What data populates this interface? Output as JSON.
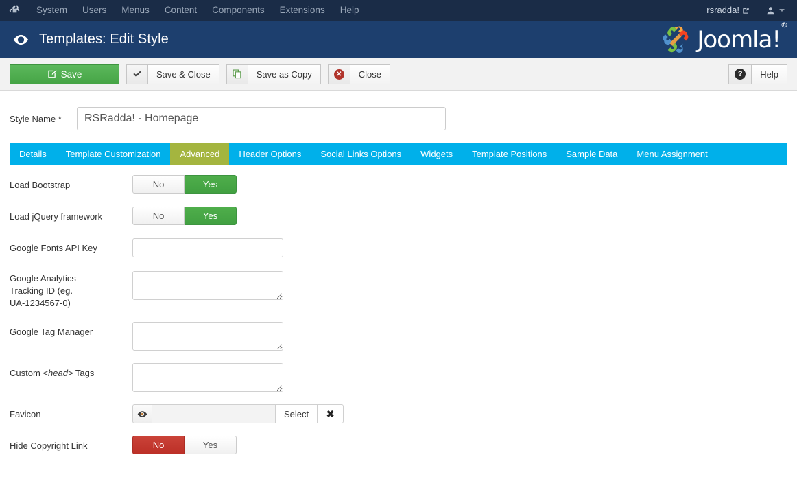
{
  "topnav": {
    "brand_icon": "joomla-mark-icon",
    "items": [
      {
        "label": "System"
      },
      {
        "label": "Users"
      },
      {
        "label": "Menus"
      },
      {
        "label": "Content"
      },
      {
        "label": "Components"
      },
      {
        "label": "Extensions"
      },
      {
        "label": "Help"
      }
    ],
    "site_link_label": "rsradda!",
    "site_link_icon": "external-link-icon",
    "user_icon": "user-icon",
    "caret_icon": "chevron-down-icon"
  },
  "header": {
    "icon": "eye-icon",
    "title": "Templates: Edit Style",
    "logo_text": "Joomla!",
    "logo_registered": "®"
  },
  "toolbar": {
    "save_label": "Save",
    "save_icon": "pencil-square-icon",
    "save_close_label": "Save & Close",
    "save_close_icon": "check-icon",
    "save_copy_label": "Save as Copy",
    "save_copy_icon": "copy-icon",
    "close_label": "Close",
    "close_icon": "x-circle-icon",
    "help_label": "Help",
    "help_icon": "question-circle-icon"
  },
  "style_name": {
    "label": "Style Name *",
    "value": "RSRadda! - Homepage",
    "placeholder": ""
  },
  "tabs": [
    {
      "label": "Details",
      "active": false
    },
    {
      "label": "Template Customization",
      "active": false
    },
    {
      "label": "Advanced",
      "active": true
    },
    {
      "label": "Header Options",
      "active": false
    },
    {
      "label": "Social Links Options",
      "active": false
    },
    {
      "label": "Widgets",
      "active": false
    },
    {
      "label": "Template Positions",
      "active": false
    },
    {
      "label": "Sample Data",
      "active": false
    },
    {
      "label": "Menu Assignment",
      "active": false
    }
  ],
  "fields": {
    "load_bootstrap": {
      "label": "Load Bootstrap",
      "option_no": "No",
      "option_yes": "Yes",
      "selected": "Yes"
    },
    "load_jquery": {
      "label": "Load jQuery framework",
      "option_no": "No",
      "option_yes": "Yes",
      "selected": "Yes"
    },
    "google_fonts_api_key": {
      "label": "Google Fonts API Key",
      "value": "",
      "placeholder": ""
    },
    "google_analytics": {
      "label_line1": "Google Analytics",
      "label_line2": "Tracking ID (eg.",
      "label_line3": "UA-1234567-0)",
      "value": "",
      "placeholder": ""
    },
    "google_tag_manager": {
      "label": "Google Tag Manager",
      "value": "",
      "placeholder": ""
    },
    "custom_head_tags": {
      "label_prefix": "Custom ",
      "label_italic": "<head>",
      "label_suffix": " Tags",
      "value": "",
      "placeholder": ""
    },
    "favicon": {
      "label": "Favicon",
      "value": "",
      "placeholder": "",
      "preview_icon": "eye-icon",
      "select_label": "Select",
      "clear_icon": "x-icon"
    },
    "hide_copyright_link": {
      "label": "Hide Copyright Link",
      "option_no": "No",
      "option_yes": "Yes",
      "selected": "No"
    }
  },
  "colors": {
    "topnav_bg": "#1a2c47",
    "header_bg": "#1d3f6e",
    "tabs_bg": "#00b0ea",
    "tab_active_bg": "#a4b53f",
    "toggle_on_green": "#41a041",
    "toggle_on_red": "#bc3027",
    "save_green": "#46a546"
  }
}
